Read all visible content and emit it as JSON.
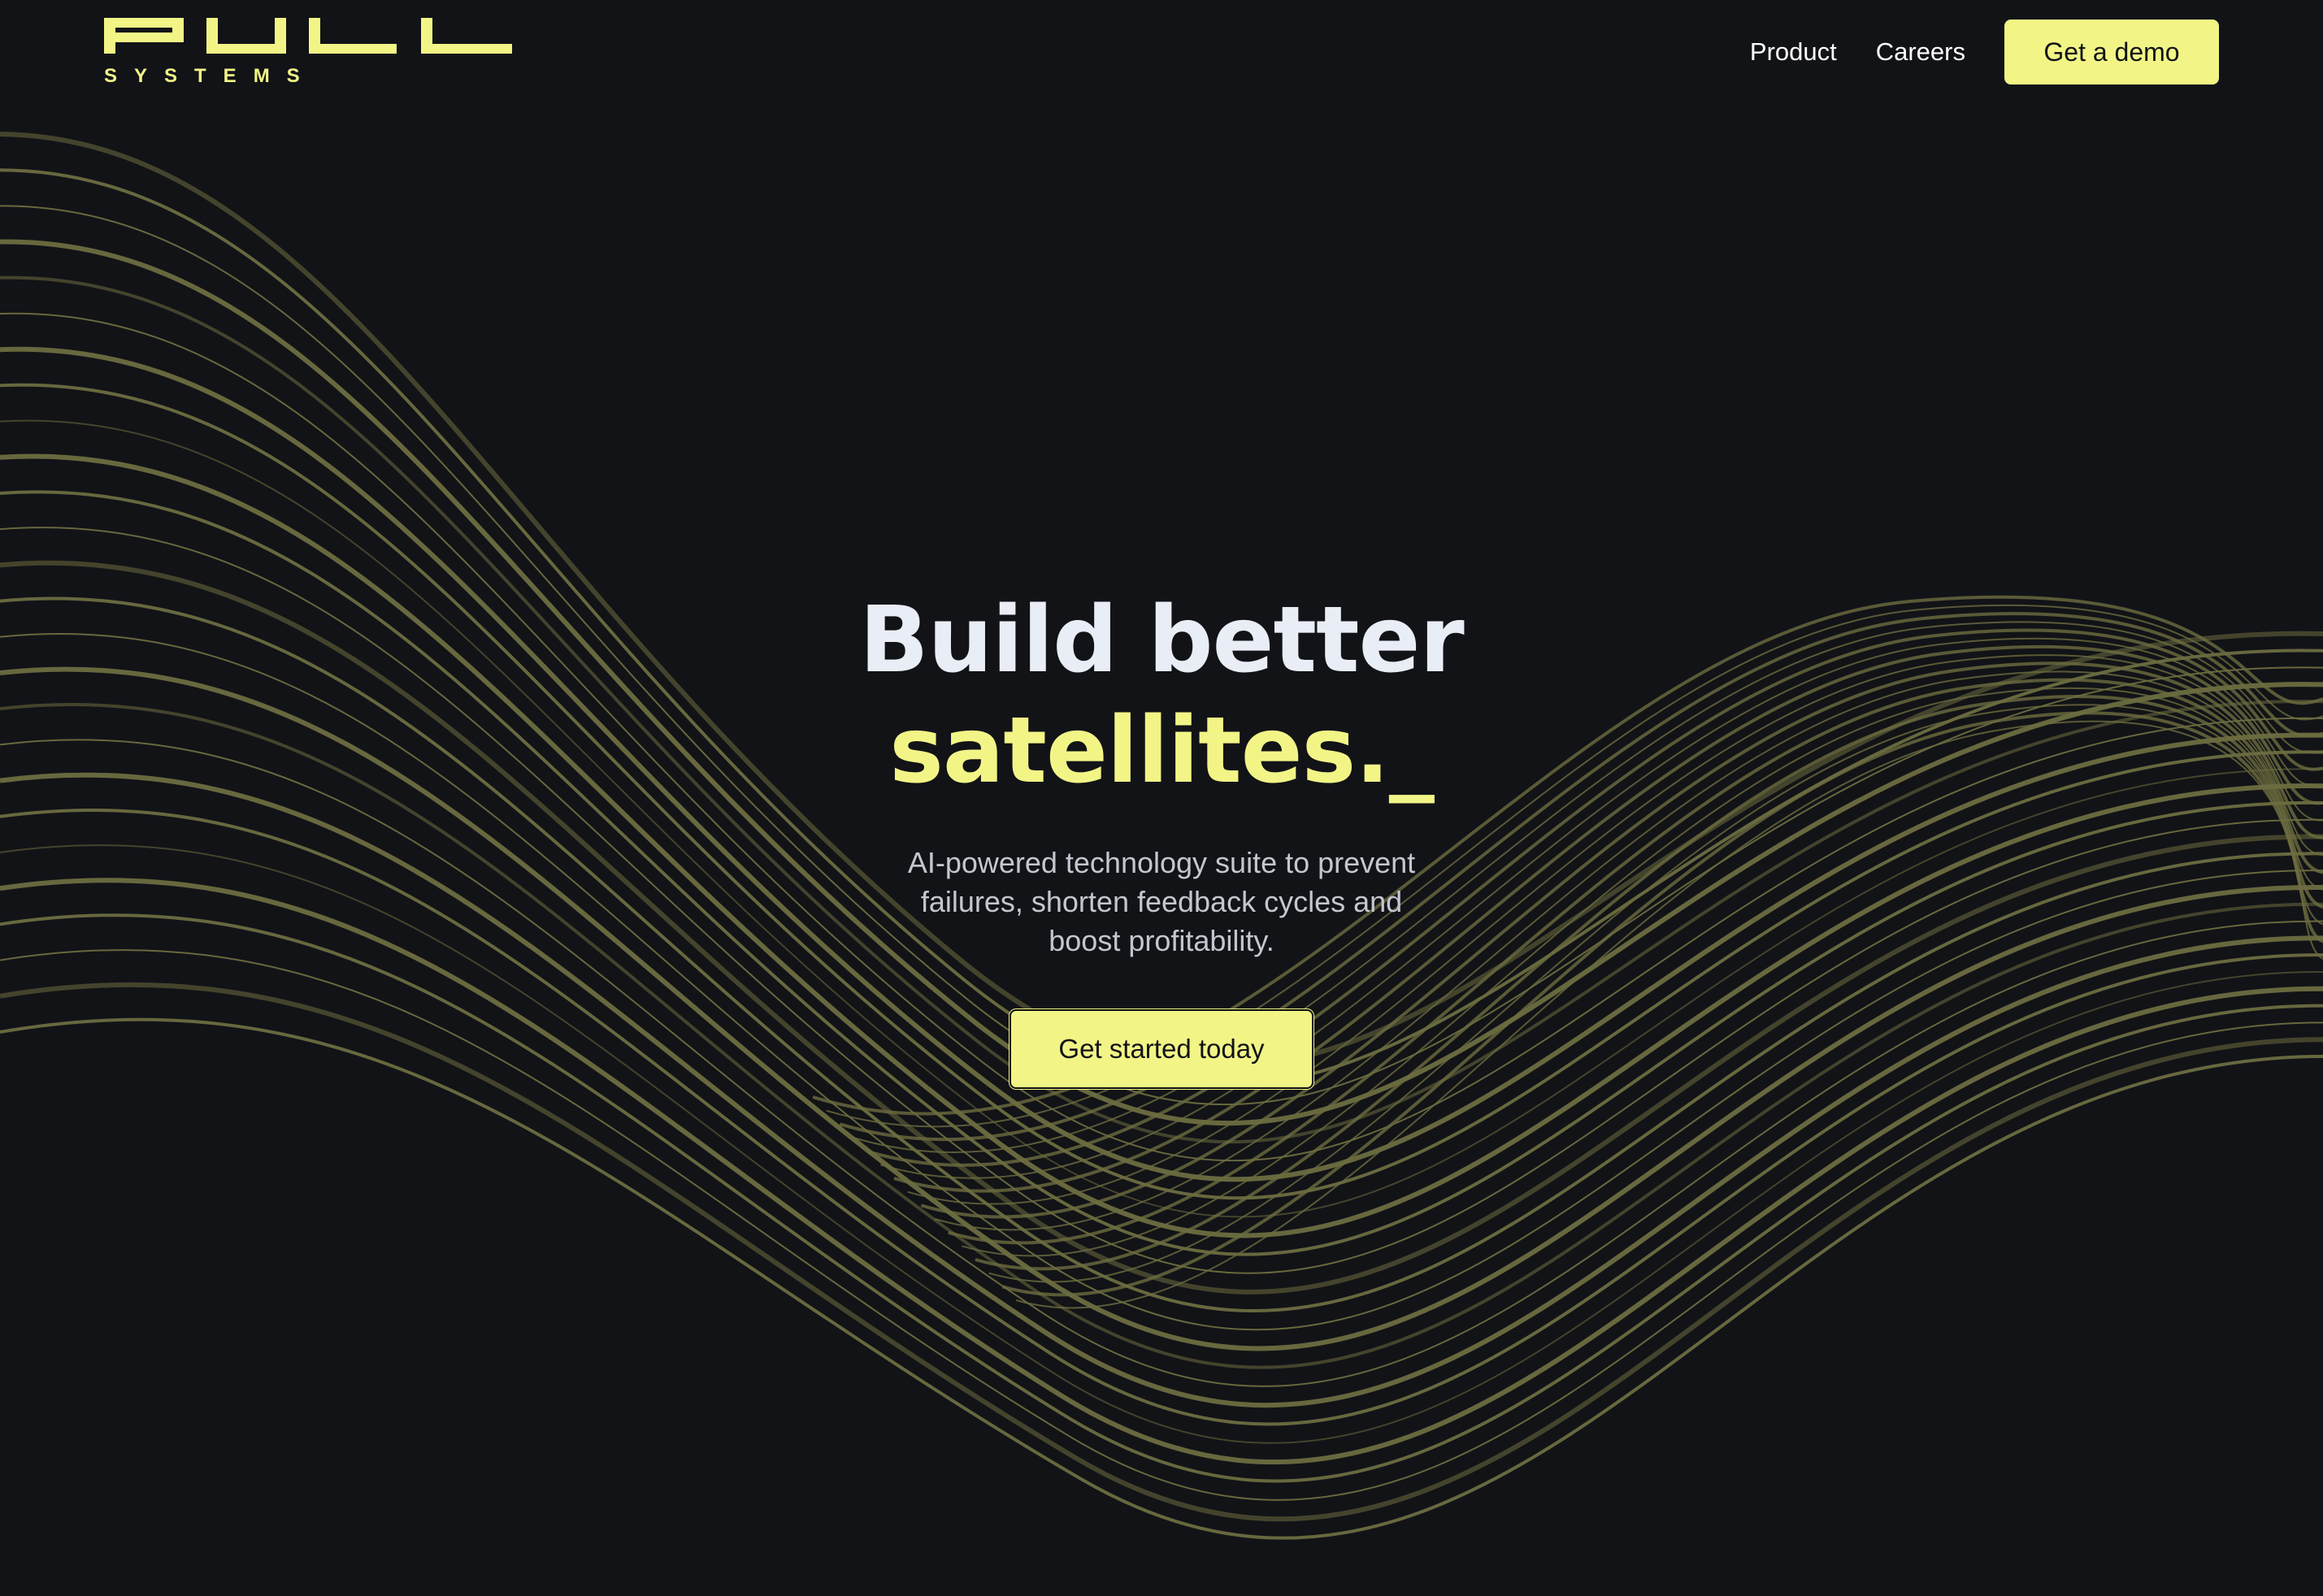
{
  "brand": {
    "sub_text": "SYSTEMS",
    "accent_color": "#f2f586",
    "background_color": "#121317",
    "wave_color": "#6d6d40"
  },
  "nav": {
    "links": [
      {
        "label": "Product"
      },
      {
        "label": "Careers"
      }
    ],
    "demo_label": "Get a demo"
  },
  "hero": {
    "title_line1": "Build better",
    "title_line2": "satellites._",
    "subtitle": "AI-powered technology suite to prevent failures, shorten feedback cycles and boost profitability.",
    "cta_label": "Get started today"
  }
}
